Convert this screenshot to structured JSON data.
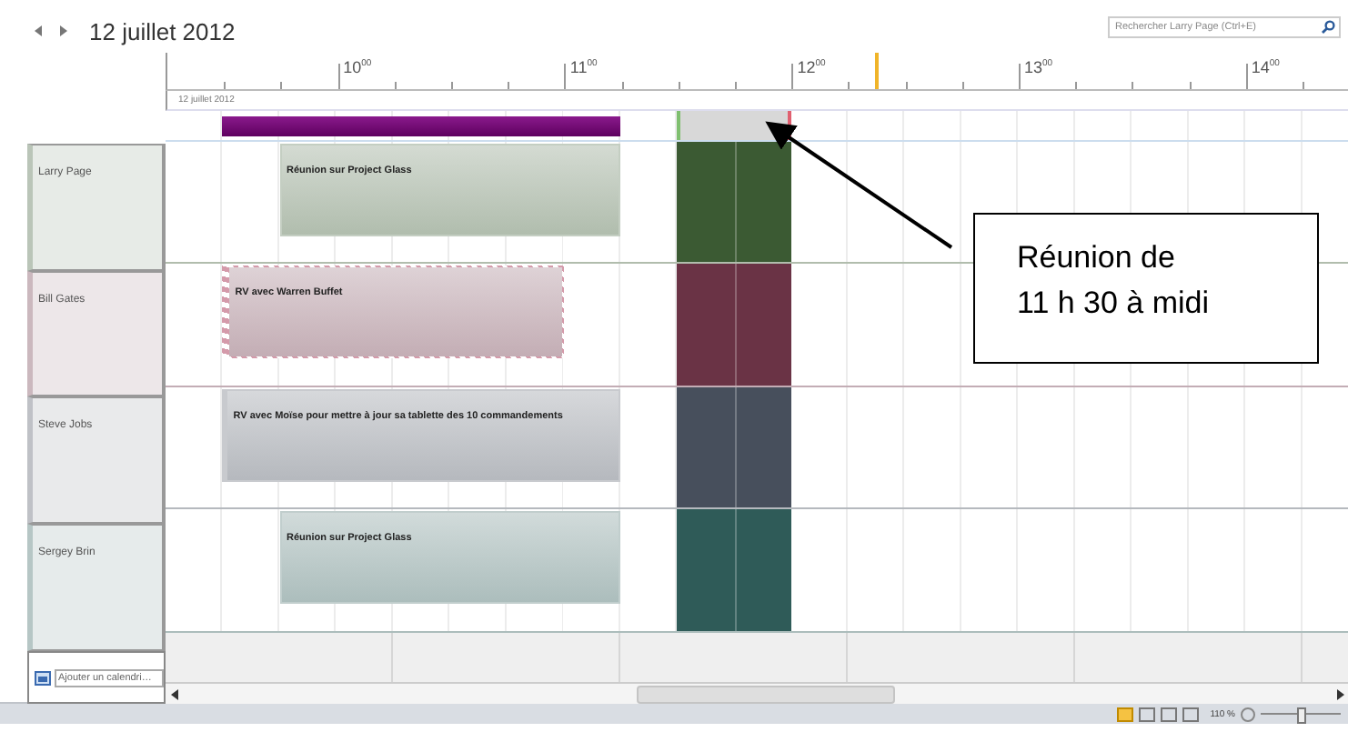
{
  "header": {
    "date": "12 juillet 2012",
    "search": {
      "placeholder": "Rechercher Larry Page (Ctrl+E)"
    }
  },
  "ruler": {
    "hours": [
      "10$^{00}$",
      "11$^{00}$",
      "12$^{00}$",
      "13$^{00}$",
      "14$^{00}$"
    ],
    "date_label": "12 juillet 2012"
  },
  "people": [
    {
      "name": "Larry Page",
      "color": "#3b5a33",
      "event": {
        "title": "Réunion sur Project Glass",
        "kind": "plain"
      }
    },
    {
      "name": "Bill Gates",
      "color": "#6a3345",
      "event": {
        "title": "RV avec Warren Buffet",
        "kind": "tentative"
      }
    },
    {
      "name": "Steve Jobs",
      "color": "#474f5c",
      "event": {
        "title": "RV avec Moïse pour mettre à jour sa tablette des 10 commandements",
        "kind": "marked"
      }
    },
    {
      "name": "Sergey Brin",
      "color": "#2f5b58",
      "event": {
        "title": "Réunion sur Project Glass",
        "kind": "plain"
      }
    }
  ],
  "add_calendar": {
    "placeholder": "Ajouter un calendri…"
  },
  "status_bar": {
    "zoom": "110 %",
    "zoom_slider": {
      "level": 0.5
    }
  },
  "callout": {
    "lines": [
      "Réunion de",
      "11 h 30 à midi"
    ]
  }
}
